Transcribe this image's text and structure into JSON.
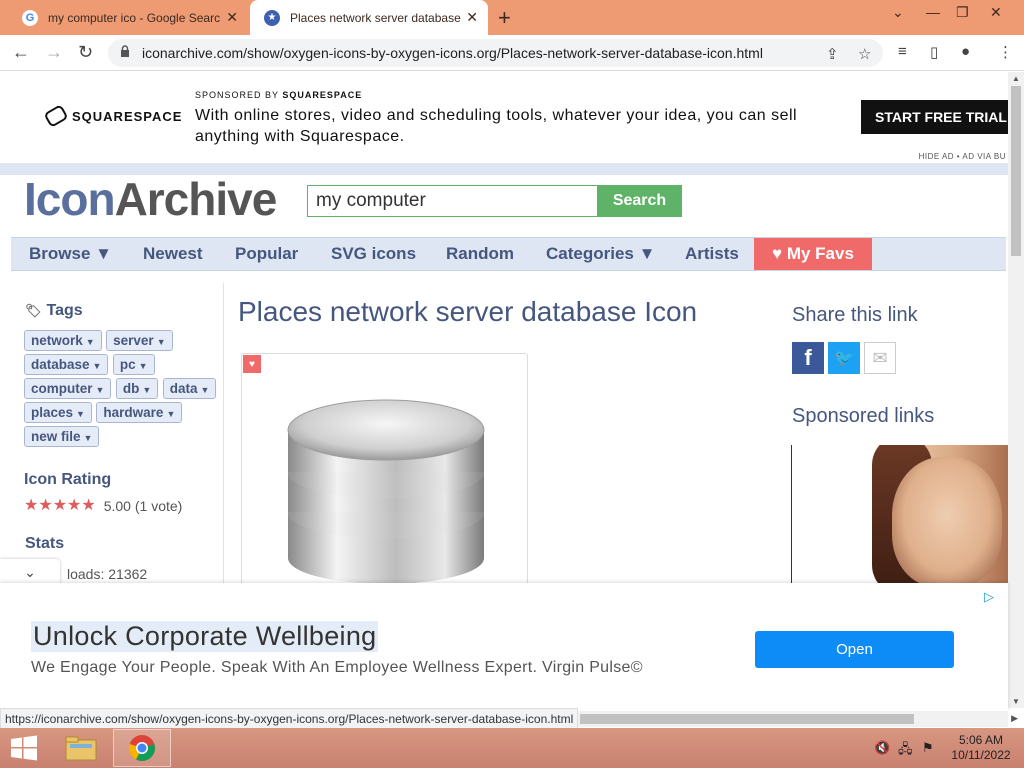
{
  "browser": {
    "tabs": [
      {
        "title": "my computer ico - Google Search",
        "favicon": "google-icon"
      },
      {
        "title": "Places network server database Icon",
        "favicon": "iconarchive-icon"
      }
    ],
    "url": "iconarchive.com/show/oxygen-icons-by-oxygen-icons.org/Places-network-server-database-icon.html",
    "status_url": "https://iconarchive.com/show/oxygen-icons-by-oxygen-icons.org/Places-network-server-database-icon.html"
  },
  "top_ad": {
    "brand": "SQUARESPACE",
    "sponsored_prefix": "SPONSORED BY",
    "sponsored_brand": "SQUARESPACE",
    "text": "With online stores, video and scheduling tools, whatever your idea, you can sell anything with Squarespace.",
    "cta": "START FREE TRIAL N",
    "hide": "HIDE AD • AD VIA BU"
  },
  "site": {
    "logo_part1": "Icon",
    "logo_part2": "Archive",
    "search_value": "my computer",
    "search_button": "Search",
    "nav": [
      "Browse ▼",
      "Newest",
      "Popular",
      "SVG icons",
      "Random",
      "Categories ▼",
      "Artists",
      "♥ My Favs"
    ]
  },
  "sidebar": {
    "tags_title": "Tags",
    "tags": [
      "network",
      "server",
      "database",
      "pc",
      "computer",
      "db",
      "data",
      "places",
      "hardware",
      "new file"
    ],
    "rating_title": "Icon Rating",
    "rating_value": 5,
    "rating_text": "5.00 (1 vote)",
    "stats_title": "Stats",
    "downloads_text": "loads: 21362"
  },
  "main": {
    "title": "Places network server database Icon"
  },
  "right": {
    "share_title": "Share this link",
    "sponsored_title": "Sponsored links"
  },
  "bottom_ad": {
    "title": "Unlock Corporate Wellbeing",
    "subtitle": "We Engage Your People. Speak With An Employee Wellness Expert. Virgin Pulse©",
    "button": "Open"
  },
  "taskbar": {
    "time": "5:06 AM",
    "date": "10/11/2022"
  },
  "colors": {
    "tab_strip": "#ee9a73",
    "accent_blue": "#45577f",
    "search_green": "#5fb368",
    "favs_red": "#f16a6a",
    "open_blue": "#0d8cf7"
  }
}
